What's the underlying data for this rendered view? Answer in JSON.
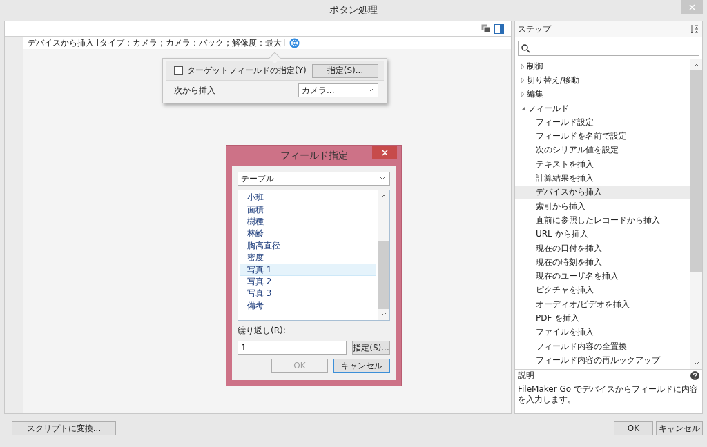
{
  "window": {
    "title": "ボタン処理"
  },
  "script_lines": [
    {
      "text": "デバイスから挿入 [タイプ：カメラ；カメラ：バック；解像度：最大]"
    }
  ],
  "popover": {
    "target_checkbox": {
      "label": "ターゲットフィールドの指定(Y)",
      "checked": false
    },
    "specify_button": "指定(S)...",
    "insert_from": {
      "label": "次から挿入",
      "value": "カメラ..."
    }
  },
  "field_dialog": {
    "title": "フィールド指定",
    "table_select": "テーブル",
    "fields": [
      {
        "label": "小班",
        "selected": false
      },
      {
        "label": "面積",
        "selected": false
      },
      {
        "label": "樹種",
        "selected": false
      },
      {
        "label": "林齢",
        "selected": false
      },
      {
        "label": "胸高直径",
        "selected": false
      },
      {
        "label": "密度",
        "selected": false
      },
      {
        "label": "写真 1",
        "selected": true
      },
      {
        "label": "写真 2",
        "selected": false
      },
      {
        "label": "写真 3",
        "selected": false
      },
      {
        "label": "備考",
        "selected": false
      }
    ],
    "repetition_label": "繰り返し(R):",
    "repetition_value": "1",
    "specify_button": "指定(S)...",
    "ok": {
      "label": "OK",
      "disabled": true
    },
    "cancel": "キャンセル"
  },
  "steps_panel": {
    "header": "ステップ",
    "tree": [
      {
        "label": "制御",
        "expanded": false,
        "selected": false
      },
      {
        "label": "切り替え/移動",
        "expanded": false,
        "selected": false
      },
      {
        "label": "編集",
        "expanded": false,
        "selected": false
      },
      {
        "label": "フィールド",
        "expanded": true,
        "selected": false,
        "children": [
          {
            "label": "フィールド設定",
            "selected": false
          },
          {
            "label": "フィールドを名前で設定",
            "selected": false
          },
          {
            "label": "次のシリアル値を設定",
            "selected": false
          },
          {
            "label": "テキストを挿入",
            "selected": false
          },
          {
            "label": "計算結果を挿入",
            "selected": false
          },
          {
            "label": "デバイスから挿入",
            "selected": true
          },
          {
            "label": "索引から挿入",
            "selected": false
          },
          {
            "label": "直前に参照したレコードから挿入",
            "selected": false
          },
          {
            "label": "URL から挿入",
            "selected": false
          },
          {
            "label": "現在の日付を挿入",
            "selected": false
          },
          {
            "label": "現在の時刻を挿入",
            "selected": false
          },
          {
            "label": "現在のユーザ名を挿入",
            "selected": false
          },
          {
            "label": "ピクチャを挿入",
            "selected": false
          },
          {
            "label": "オーディオ/ビデオを挿入",
            "selected": false
          },
          {
            "label": "PDF を挿入",
            "selected": false
          },
          {
            "label": "ファイルを挿入",
            "selected": false
          },
          {
            "label": "フィールド内容の全置換",
            "selected": false
          },
          {
            "label": "フィールド内容の再ルックアップ",
            "selected": false
          }
        ]
      }
    ],
    "description_header": "説明",
    "description": "FileMaker Go でデバイスからフィールドに内容を入力します。"
  },
  "footer": {
    "convert_button": "スクリプトに変換...",
    "ok_button": "OK",
    "cancel_button": "キャンセル"
  }
}
